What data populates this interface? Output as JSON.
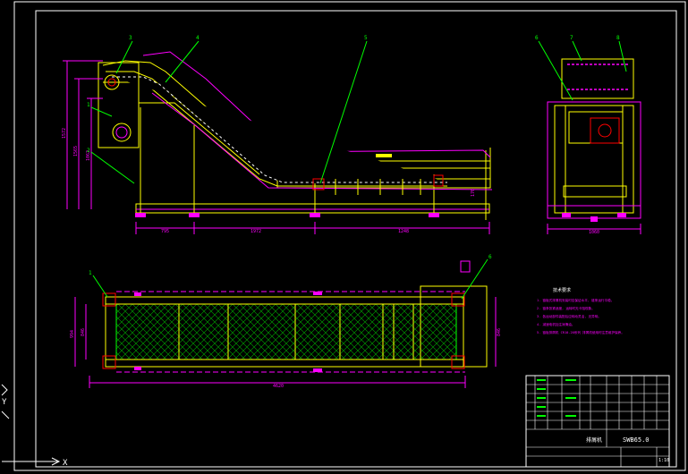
{
  "drawing": {
    "part_labels": {
      "side_view": [
        "3",
        "4",
        "5",
        "1",
        "2"
      ],
      "end_view": [
        "6",
        "7",
        "8"
      ],
      "plan_view": [
        "1",
        "6"
      ]
    },
    "dimensions": {
      "side_vertical": [
        "1572",
        "1565",
        "1062"
      ],
      "side_horizontal": [
        "795",
        "1972",
        "1248"
      ],
      "side_small": [
        "170"
      ],
      "end_bottom": "1060",
      "plan_left": [
        "994",
        "846"
      ],
      "plan_bottom": "4620",
      "plan_right": "846"
    },
    "notes": {
      "heading": "技术要求",
      "items": [
        "1. 链板式排屑机安装时应保证水平, 链条运行平稳。",
        "2. 链条张紧适度, 运转时无卡阻现象。",
        "3. 各运动部件装配后应转动灵活, 无异响。",
        "4. 减速电机加注润滑油。",
        "5. 链板排屑机 CR10-20系列 排屑机使用时注意维护保养。"
      ]
    },
    "title_block": {
      "name": "排屑机",
      "code": "SWB65.0",
      "scale": "1:10"
    },
    "ucs": {
      "x_axis": "X",
      "y_axis": "Y"
    },
    "colors": {
      "background": "#000000",
      "frame": "#ffffff",
      "outline": "#ffff00",
      "dims": "#ff00ff",
      "leader": "#00ff00",
      "hidden": "#ff0000",
      "mesh": "#00aa00"
    }
  }
}
